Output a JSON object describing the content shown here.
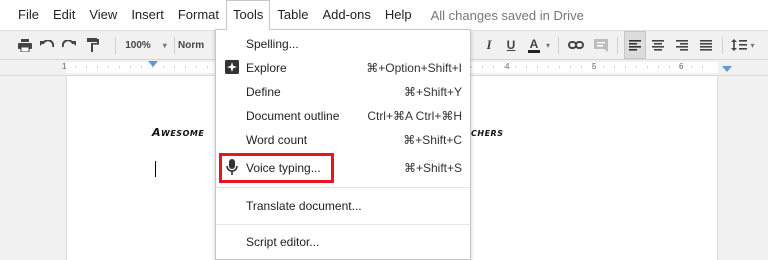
{
  "menubar": {
    "items": [
      "File",
      "Edit",
      "View",
      "Insert",
      "Format",
      "Tools",
      "Table",
      "Add-ons",
      "Help"
    ],
    "status": "All changes saved in Drive"
  },
  "toolbar": {
    "zoom": "100%",
    "style_partial": "Norm",
    "format_partial": [
      "I",
      "U",
      "A"
    ],
    "icons": [
      "print-icon",
      "undo-icon",
      "redo-icon",
      "paint-format-icon",
      "link-icon",
      "comment-icon",
      "align-left-icon",
      "align-center-icon",
      "align-right-icon",
      "justify-icon",
      "line-spacing-icon"
    ]
  },
  "ruler": {
    "numbers": [
      "1",
      "4",
      "5",
      "6"
    ]
  },
  "document": {
    "heading_left": "Awesome",
    "heading_right": "chers"
  },
  "tools_menu": {
    "items": [
      {
        "label": "Spelling...",
        "shortcut": ""
      },
      {
        "label": "Explore",
        "shortcut": "⌘+Option+Shift+I",
        "icon": "explore-icon"
      },
      {
        "label": "Define",
        "shortcut": "⌘+Shift+Y"
      },
      {
        "label": "Document outline",
        "shortcut": "Ctrl+⌘A Ctrl+⌘H"
      },
      {
        "label": "Word count",
        "shortcut": "⌘+Shift+C"
      },
      {
        "label": "Voice typing...",
        "shortcut": "⌘+Shift+S",
        "icon": "microphone-icon"
      },
      {
        "label": "Translate document...",
        "shortcut": ""
      },
      {
        "label": "Script editor...",
        "shortcut": ""
      }
    ],
    "highlight_color": "#e8141e"
  }
}
